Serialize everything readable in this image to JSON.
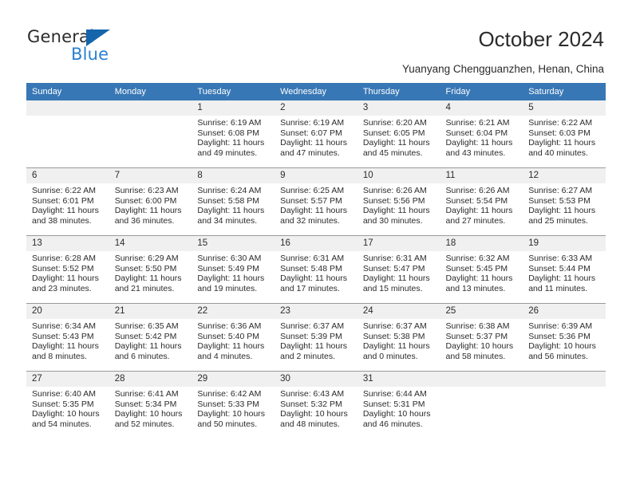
{
  "logo": {
    "word_top": "General",
    "word_bottom": "Blue",
    "triangle_icon": "blue-triangle-icon",
    "color_dark": "#2b2b2b",
    "color_blue": "#2a81d0"
  },
  "header": {
    "title": "October 2024",
    "subtitle": "Yuanyang Chengguanzhen, Henan, China"
  },
  "theme": {
    "header_row_bg": "#3877b5",
    "header_row_text": "#ffffff",
    "daynum_bg": "#f0f0f0",
    "cell_border": "#9a9a9a",
    "body_text": "#2b2b2b"
  },
  "calendar": {
    "weekday_headers": [
      "Sunday",
      "Monday",
      "Tuesday",
      "Wednesday",
      "Thursday",
      "Friday",
      "Saturday"
    ],
    "weeks": [
      [
        {
          "day": "",
          "lines": []
        },
        {
          "day": "",
          "lines": []
        },
        {
          "day": "1",
          "lines": [
            "Sunrise: 6:19 AM",
            "Sunset: 6:08 PM",
            "Daylight: 11 hours",
            "and 49 minutes."
          ]
        },
        {
          "day": "2",
          "lines": [
            "Sunrise: 6:19 AM",
            "Sunset: 6:07 PM",
            "Daylight: 11 hours",
            "and 47 minutes."
          ]
        },
        {
          "day": "3",
          "lines": [
            "Sunrise: 6:20 AM",
            "Sunset: 6:05 PM",
            "Daylight: 11 hours",
            "and 45 minutes."
          ]
        },
        {
          "day": "4",
          "lines": [
            "Sunrise: 6:21 AM",
            "Sunset: 6:04 PM",
            "Daylight: 11 hours",
            "and 43 minutes."
          ]
        },
        {
          "day": "5",
          "lines": [
            "Sunrise: 6:22 AM",
            "Sunset: 6:03 PM",
            "Daylight: 11 hours",
            "and 40 minutes."
          ]
        }
      ],
      [
        {
          "day": "6",
          "lines": [
            "Sunrise: 6:22 AM",
            "Sunset: 6:01 PM",
            "Daylight: 11 hours",
            "and 38 minutes."
          ]
        },
        {
          "day": "7",
          "lines": [
            "Sunrise: 6:23 AM",
            "Sunset: 6:00 PM",
            "Daylight: 11 hours",
            "and 36 minutes."
          ]
        },
        {
          "day": "8",
          "lines": [
            "Sunrise: 6:24 AM",
            "Sunset: 5:58 PM",
            "Daylight: 11 hours",
            "and 34 minutes."
          ]
        },
        {
          "day": "9",
          "lines": [
            "Sunrise: 6:25 AM",
            "Sunset: 5:57 PM",
            "Daylight: 11 hours",
            "and 32 minutes."
          ]
        },
        {
          "day": "10",
          "lines": [
            "Sunrise: 6:26 AM",
            "Sunset: 5:56 PM",
            "Daylight: 11 hours",
            "and 30 minutes."
          ]
        },
        {
          "day": "11",
          "lines": [
            "Sunrise: 6:26 AM",
            "Sunset: 5:54 PM",
            "Daylight: 11 hours",
            "and 27 minutes."
          ]
        },
        {
          "day": "12",
          "lines": [
            "Sunrise: 6:27 AM",
            "Sunset: 5:53 PM",
            "Daylight: 11 hours",
            "and 25 minutes."
          ]
        }
      ],
      [
        {
          "day": "13",
          "lines": [
            "Sunrise: 6:28 AM",
            "Sunset: 5:52 PM",
            "Daylight: 11 hours",
            "and 23 minutes."
          ]
        },
        {
          "day": "14",
          "lines": [
            "Sunrise: 6:29 AM",
            "Sunset: 5:50 PM",
            "Daylight: 11 hours",
            "and 21 minutes."
          ]
        },
        {
          "day": "15",
          "lines": [
            "Sunrise: 6:30 AM",
            "Sunset: 5:49 PM",
            "Daylight: 11 hours",
            "and 19 minutes."
          ]
        },
        {
          "day": "16",
          "lines": [
            "Sunrise: 6:31 AM",
            "Sunset: 5:48 PM",
            "Daylight: 11 hours",
            "and 17 minutes."
          ]
        },
        {
          "day": "17",
          "lines": [
            "Sunrise: 6:31 AM",
            "Sunset: 5:47 PM",
            "Daylight: 11 hours",
            "and 15 minutes."
          ]
        },
        {
          "day": "18",
          "lines": [
            "Sunrise: 6:32 AM",
            "Sunset: 5:45 PM",
            "Daylight: 11 hours",
            "and 13 minutes."
          ]
        },
        {
          "day": "19",
          "lines": [
            "Sunrise: 6:33 AM",
            "Sunset: 5:44 PM",
            "Daylight: 11 hours",
            "and 11 minutes."
          ]
        }
      ],
      [
        {
          "day": "20",
          "lines": [
            "Sunrise: 6:34 AM",
            "Sunset: 5:43 PM",
            "Daylight: 11 hours",
            "and 8 minutes."
          ]
        },
        {
          "day": "21",
          "lines": [
            "Sunrise: 6:35 AM",
            "Sunset: 5:42 PM",
            "Daylight: 11 hours",
            "and 6 minutes."
          ]
        },
        {
          "day": "22",
          "lines": [
            "Sunrise: 6:36 AM",
            "Sunset: 5:40 PM",
            "Daylight: 11 hours",
            "and 4 minutes."
          ]
        },
        {
          "day": "23",
          "lines": [
            "Sunrise: 6:37 AM",
            "Sunset: 5:39 PM",
            "Daylight: 11 hours",
            "and 2 minutes."
          ]
        },
        {
          "day": "24",
          "lines": [
            "Sunrise: 6:37 AM",
            "Sunset: 5:38 PM",
            "Daylight: 11 hours",
            "and 0 minutes."
          ]
        },
        {
          "day": "25",
          "lines": [
            "Sunrise: 6:38 AM",
            "Sunset: 5:37 PM",
            "Daylight: 10 hours",
            "and 58 minutes."
          ]
        },
        {
          "day": "26",
          "lines": [
            "Sunrise: 6:39 AM",
            "Sunset: 5:36 PM",
            "Daylight: 10 hours",
            "and 56 minutes."
          ]
        }
      ],
      [
        {
          "day": "27",
          "lines": [
            "Sunrise: 6:40 AM",
            "Sunset: 5:35 PM",
            "Daylight: 10 hours",
            "and 54 minutes."
          ]
        },
        {
          "day": "28",
          "lines": [
            "Sunrise: 6:41 AM",
            "Sunset: 5:34 PM",
            "Daylight: 10 hours",
            "and 52 minutes."
          ]
        },
        {
          "day": "29",
          "lines": [
            "Sunrise: 6:42 AM",
            "Sunset: 5:33 PM",
            "Daylight: 10 hours",
            "and 50 minutes."
          ]
        },
        {
          "day": "30",
          "lines": [
            "Sunrise: 6:43 AM",
            "Sunset: 5:32 PM",
            "Daylight: 10 hours",
            "and 48 minutes."
          ]
        },
        {
          "day": "31",
          "lines": [
            "Sunrise: 6:44 AM",
            "Sunset: 5:31 PM",
            "Daylight: 10 hours",
            "and 46 minutes."
          ]
        },
        {
          "day": "",
          "lines": []
        },
        {
          "day": "",
          "lines": []
        }
      ]
    ]
  }
}
